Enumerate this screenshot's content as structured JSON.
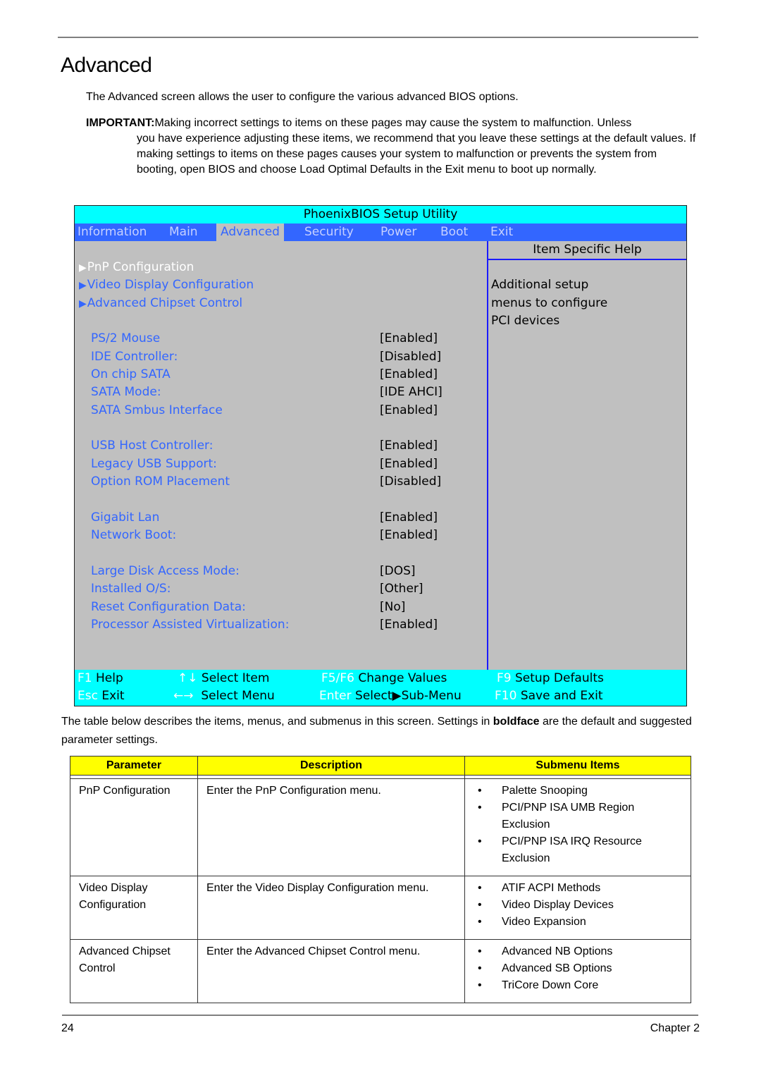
{
  "page": {
    "title": "Advanced",
    "intro": "The Advanced screen allows the user to configure the various advanced BIOS options.",
    "important_label": "IMPORTANT:",
    "important_first": "Making incorrect settings to items on these pages may cause the system to malfunction. Unless",
    "important_rest": "you have experience adjusting these items, we recommend that you leave these settings at the default values. If making settings to items on these pages causes your system to malfunction or prevents the system from booting, open BIOS and choose Load Optimal Defaults in the Exit menu to boot up normally.",
    "desc_before": "The table below describes the items, menus, and submenus in this screen. Settings in ",
    "desc_bold": "boldface",
    "desc_after": " are the default and suggested parameter settings.",
    "page_number": "24",
    "chapter": "Chapter 2"
  },
  "bios": {
    "title": "PhoenixBIOS Setup Utility",
    "menu": [
      {
        "label": "Information"
      },
      {
        "label": "Main"
      },
      {
        "label": "Advanced",
        "active": true
      },
      {
        "label": "Security"
      },
      {
        "label": "Power"
      },
      {
        "label": "Boot"
      },
      {
        "label": "Exit"
      }
    ],
    "submenus": [
      {
        "label": "PnP Configuration",
        "selected": true
      },
      {
        "label": "Video Display Configuration"
      },
      {
        "label": "Advanced Chipset Control"
      }
    ],
    "settings": [
      {
        "label": "PS/2 Mouse",
        "value": "[Enabled]"
      },
      {
        "label": "IDE Controller:",
        "value": "[Disabled]"
      },
      {
        "label": "On chip SATA",
        "value": "[Enabled]"
      },
      {
        "label": "SATA Mode:",
        "value": "[IDE AHCI]"
      },
      {
        "label": "SATA Smbus Interface",
        "value": "[Enabled]"
      },
      {
        "label": "USB Host Controller:",
        "value": "[Enabled]"
      },
      {
        "label": "Legacy USB Support:",
        "value": "[Enabled]"
      },
      {
        "label": "Option ROM Placement",
        "value": "[Disabled]"
      },
      {
        "label": "Gigabit Lan",
        "value": "[Enabled]"
      },
      {
        "label": "Network Boot:",
        "value": "[Enabled]"
      },
      {
        "label": "Large Disk Access Mode:",
        "value": "[DOS]"
      },
      {
        "label": "Installed O/S:",
        "value": "[Other]"
      },
      {
        "label": "Reset Configuration Data:",
        "value": "[No]"
      },
      {
        "label": "Processor Assisted Virtualization:",
        "value": "[Enabled]"
      }
    ],
    "help": {
      "title": "Item Specific Help",
      "lines": [
        "Additional setup",
        "menus to configure",
        "PCI devices"
      ]
    },
    "submenu_marker": "▶",
    "footer": [
      {
        "key": "F1",
        "desc": "Help"
      },
      {
        "key": "↑↓",
        "desc": "Select Item"
      },
      {
        "key": "F5/F6",
        "desc": "Change Values"
      },
      {
        "key": "F9",
        "desc": "Setup Defaults"
      },
      {
        "key": "Esc",
        "desc": "Exit"
      },
      {
        "key": "←→",
        "desc": "Select Menu"
      },
      {
        "key": "Enter",
        "desc": "Select▶Sub-Menu"
      },
      {
        "key": "F10",
        "desc": "Save and Exit"
      }
    ],
    "colors": {
      "title_bar": "#00ffff",
      "menu_bar": "#3366ff",
      "panel": "#c0c0c0",
      "item_text": "#3366ff",
      "selected_text": "#ffffff"
    }
  },
  "table": {
    "headers": [
      "Parameter",
      "Description",
      "Submenu Items"
    ],
    "header_color": "#ffff00",
    "rows": [
      {
        "parameter": "PnP Configuration",
        "description": "Enter the PnP Configuration menu.",
        "items": [
          "Palette Snooping",
          "PCI/PNP ISA UMB Region Exclusion",
          "PCI/PNP ISA IRQ Resource Exclusion"
        ]
      },
      {
        "parameter": "Video Display Configuration",
        "description": "Enter the Video Display Configuration menu.",
        "items": [
          "ATIF ACPI Methods",
          "Video Display Devices",
          "Video Expansion"
        ]
      },
      {
        "parameter": "Advanced Chipset Control",
        "description": "Enter the Advanced Chipset Control menu.",
        "items": [
          "Advanced NB Options",
          "Advanced SB Options",
          "TriCore Down Core"
        ]
      }
    ]
  }
}
